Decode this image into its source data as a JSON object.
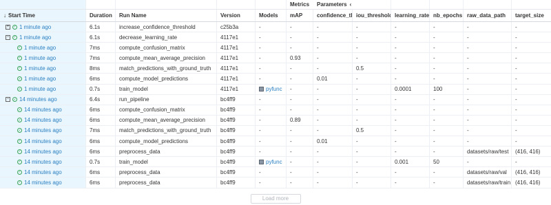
{
  "groups": {
    "metrics": "Metrics",
    "parameters": "Parameters"
  },
  "columns": {
    "start_time": "Start Time",
    "duration": "Duration",
    "run_name": "Run Name",
    "version": "Version",
    "models": "Models",
    "map": "mAP",
    "confidence": "confidence_thr",
    "iou": "iou_threshold",
    "lr": "learning_rate",
    "epochs": "nb_epochs",
    "raw_data_path": "raw_data_path",
    "target_size": "target_size"
  },
  "rows": [
    {
      "level": 0,
      "toggle": "+",
      "time": "1 minute ago",
      "duration": "6.1s",
      "run_name": "increase_confidence_threshold",
      "version": "c25b3a",
      "models": "-",
      "map": "-",
      "confidence": "-",
      "iou": "-",
      "lr": "-",
      "epochs": "-",
      "raw": "-",
      "target": "-"
    },
    {
      "level": 0,
      "toggle": "−",
      "time": "1 minute ago",
      "duration": "6.1s",
      "run_name": "decrease_learning_rate",
      "version": "4117e1",
      "models": "-",
      "map": "-",
      "confidence": "-",
      "iou": "-",
      "lr": "-",
      "epochs": "-",
      "raw": "-",
      "target": "-"
    },
    {
      "level": 1,
      "time": "1 minute ago",
      "duration": "7ms",
      "run_name": "compute_confusion_matrix",
      "version": "4117e1",
      "models": "-",
      "map": "-",
      "confidence": "-",
      "iou": "-",
      "lr": "-",
      "epochs": "-",
      "raw": "-",
      "target": "-"
    },
    {
      "level": 1,
      "time": "1 minute ago",
      "duration": "7ms",
      "run_name": "compute_mean_average_precision",
      "version": "4117e1",
      "models": "-",
      "map": "0.93",
      "confidence": "-",
      "iou": "-",
      "lr": "-",
      "epochs": "-",
      "raw": "-",
      "target": "-"
    },
    {
      "level": 1,
      "time": "1 minute ago",
      "duration": "8ms",
      "run_name": "match_predictions_with_ground_truth",
      "version": "4117e1",
      "models": "-",
      "map": "-",
      "confidence": "-",
      "iou": "0.5",
      "lr": "-",
      "epochs": "-",
      "raw": "-",
      "target": "-"
    },
    {
      "level": 1,
      "time": "1 minute ago",
      "duration": "6ms",
      "run_name": "compute_model_predictions",
      "version": "4117e1",
      "models": "-",
      "map": "-",
      "confidence": "0.01",
      "iou": "-",
      "lr": "-",
      "epochs": "-",
      "raw": "-",
      "target": "-"
    },
    {
      "level": 1,
      "time": "1 minute ago",
      "duration": "0.7s",
      "run_name": "train_model",
      "version": "4117e1",
      "models": "pyfunc",
      "map": "-",
      "confidence": "-",
      "iou": "-",
      "lr": "0.0001",
      "epochs": "100",
      "raw": "-",
      "target": "-"
    },
    {
      "level": 0,
      "toggle": "−",
      "time": "14 minutes ago",
      "duration": "6.4s",
      "run_name": "run_pipeline",
      "version": "bc4ff9",
      "models": "-",
      "map": "-",
      "confidence": "-",
      "iou": "-",
      "lr": "-",
      "epochs": "-",
      "raw": "-",
      "target": "-"
    },
    {
      "level": 1,
      "time": "14 minutes ago",
      "duration": "6ms",
      "run_name": "compute_confusion_matrix",
      "version": "bc4ff9",
      "models": "-",
      "map": "-",
      "confidence": "-",
      "iou": "-",
      "lr": "-",
      "epochs": "-",
      "raw": "-",
      "target": "-"
    },
    {
      "level": 1,
      "time": "14 minutes ago",
      "duration": "6ms",
      "run_name": "compute_mean_average_precision",
      "version": "bc4ff9",
      "models": "-",
      "map": "0.89",
      "confidence": "-",
      "iou": "-",
      "lr": "-",
      "epochs": "-",
      "raw": "-",
      "target": "-"
    },
    {
      "level": 1,
      "time": "14 minutes ago",
      "duration": "7ms",
      "run_name": "match_predictions_with_ground_truth",
      "version": "bc4ff9",
      "models": "-",
      "map": "-",
      "confidence": "-",
      "iou": "0.5",
      "lr": "-",
      "epochs": "-",
      "raw": "-",
      "target": "-"
    },
    {
      "level": 1,
      "time": "14 minutes ago",
      "duration": "6ms",
      "run_name": "compute_model_predictions",
      "version": "bc4ff9",
      "models": "-",
      "map": "-",
      "confidence": "0.01",
      "iou": "-",
      "lr": "-",
      "epochs": "-",
      "raw": "-",
      "target": "-"
    },
    {
      "level": 1,
      "time": "14 minutes ago",
      "duration": "6ms",
      "run_name": "preprocess_data",
      "version": "bc4ff9",
      "models": "-",
      "map": "-",
      "confidence": "-",
      "iou": "-",
      "lr": "-",
      "epochs": "-",
      "raw": "datasets/raw/test",
      "target": "(416, 416)"
    },
    {
      "level": 1,
      "time": "14 minutes ago",
      "duration": "0.7s",
      "run_name": "train_model",
      "version": "bc4ff9",
      "models": "pyfunc",
      "map": "-",
      "confidence": "-",
      "iou": "-",
      "lr": "0.001",
      "epochs": "50",
      "raw": "-",
      "target": "-"
    },
    {
      "level": 1,
      "time": "14 minutes ago",
      "duration": "6ms",
      "run_name": "preprocess_data",
      "version": "bc4ff9",
      "models": "-",
      "map": "-",
      "confidence": "-",
      "iou": "-",
      "lr": "-",
      "epochs": "-",
      "raw": "datasets/raw/val",
      "target": "(416, 416)"
    },
    {
      "level": 1,
      "time": "14 minutes ago",
      "duration": "6ms",
      "run_name": "preprocess_data",
      "version": "bc4ff9",
      "models": "-",
      "map": "-",
      "confidence": "-",
      "iou": "-",
      "lr": "-",
      "epochs": "-",
      "raw": "datasets/raw/train",
      "target": "(416, 416)"
    }
  ],
  "footer": {
    "load_more": "Load more"
  },
  "colors": {
    "link": "#2a7fc1",
    "success": "#3ba55c",
    "selected_bg": "#eaf6fd"
  }
}
